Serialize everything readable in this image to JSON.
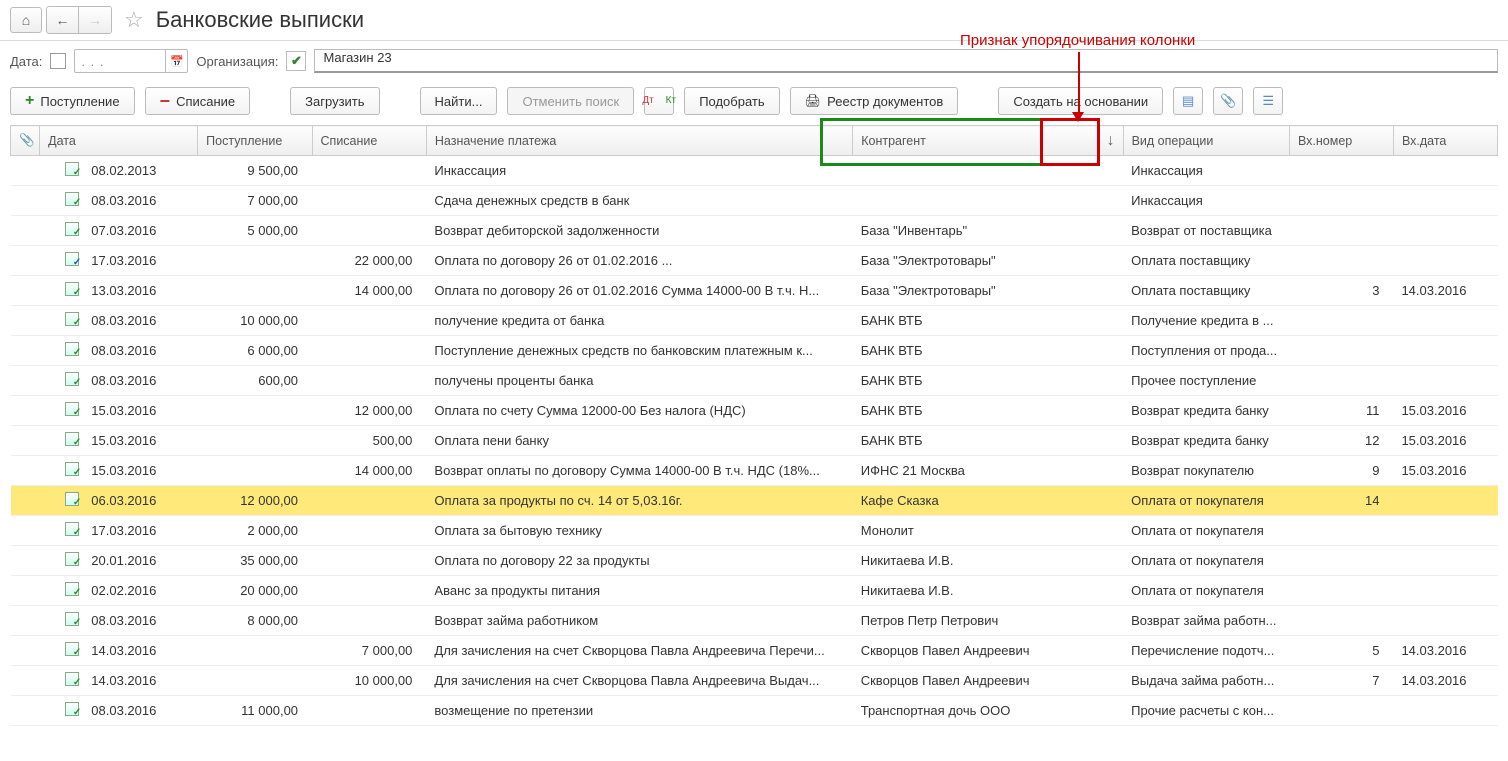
{
  "header": {
    "title": "Банковские выписки"
  },
  "filter": {
    "date_label": "Дата:",
    "date_placeholder": ". . .",
    "org_label": "Организация:",
    "org_value": "Магазин 23"
  },
  "toolbar": {
    "receipt": "Поступление",
    "write_off": "Списание",
    "load": "Загрузить",
    "find": "Найти...",
    "cancel_search": "Отменить поиск",
    "pick": "Подобрать",
    "registry": "Реестр документов",
    "create_based": "Создать на основании"
  },
  "columns": {
    "attach": "",
    "date": "Дата",
    "in": "Поступление",
    "out": "Списание",
    "purpose": "Назначение платежа",
    "agent": "Контрагент",
    "sort_indicator": "↓",
    "op": "Вид операции",
    "num": "Вх.номер",
    "indate": "Вх.дата"
  },
  "annotation": {
    "text": "Признак упорядочивания колонки"
  },
  "rows": [
    {
      "icon": "g",
      "date": "08.02.2013",
      "in": "9 500,00",
      "out": "",
      "purpose": "Инкассация",
      "agent": "",
      "op": "Инкассация",
      "num": "",
      "indate": ""
    },
    {
      "icon": "g",
      "date": "08.03.2016",
      "in": "7 000,00",
      "out": "",
      "purpose": "Сдача денежных средств в банк",
      "agent": "",
      "op": "Инкассация",
      "num": "",
      "indate": ""
    },
    {
      "icon": "g",
      "date": "07.03.2016",
      "in": "5 000,00",
      "out": "",
      "purpose": "Возврат дебиторской задолженности",
      "agent": "База \"Инвентарь\"",
      "op": "Возврат от поставщика",
      "num": "",
      "indate": ""
    },
    {
      "icon": "b",
      "date": "17.03.2016",
      "in": "",
      "out": "22 000,00",
      "purpose": "Оплата по договору 26 от 01.02.2016 ...",
      "agent": "База \"Электротовары\"",
      "op": "Оплата поставщику",
      "num": "",
      "indate": ""
    },
    {
      "icon": "g",
      "date": "13.03.2016",
      "in": "",
      "out": "14 000,00",
      "purpose": "Оплата по договору 26 от 01.02.2016 Сумма 14000-00 В т.ч. Н...",
      "agent": "База \"Электротовары\"",
      "op": "Оплата поставщику",
      "num": "3",
      "indate": "14.03.2016"
    },
    {
      "icon": "g",
      "date": "08.03.2016",
      "in": "10 000,00",
      "out": "",
      "purpose": "получение кредита от банка",
      "agent": "БАНК ВТБ",
      "op": "Получение кредита в ...",
      "num": "",
      "indate": ""
    },
    {
      "icon": "g",
      "date": "08.03.2016",
      "in": "6 000,00",
      "out": "",
      "purpose": "Поступление денежных средств по банковским платежным к...",
      "agent": "БАНК ВТБ",
      "op": "Поступления от прода...",
      "num": "",
      "indate": ""
    },
    {
      "icon": "g",
      "date": "08.03.2016",
      "in": "600,00",
      "out": "",
      "purpose": "получены проценты банка",
      "agent": "БАНК ВТБ",
      "op": "Прочее поступление",
      "num": "",
      "indate": ""
    },
    {
      "icon": "g",
      "date": "15.03.2016",
      "in": "",
      "out": "12 000,00",
      "purpose": "Оплата по счету Сумма 12000-00 Без налога (НДС)",
      "agent": "БАНК ВТБ",
      "op": "Возврат кредита банку",
      "num": "11",
      "indate": "15.03.2016"
    },
    {
      "icon": "g",
      "date": "15.03.2016",
      "in": "",
      "out": "500,00",
      "purpose": "Оплата пени банку",
      "agent": "БАНК ВТБ",
      "op": "Возврат кредита банку",
      "num": "12",
      "indate": "15.03.2016"
    },
    {
      "icon": "g",
      "date": "15.03.2016",
      "in": "",
      "out": "14 000,00",
      "purpose": "Возврат оплаты по договору Сумма 14000-00 В т.ч. НДС  (18%...",
      "agent": "ИФНС 21 Москва",
      "op": "Возврат покупателю",
      "num": "9",
      "indate": "15.03.2016"
    },
    {
      "icon": "g",
      "date": "06.03.2016",
      "in": "12 000,00",
      "out": "",
      "purpose": "Оплата за продукты по сч. 14 от 5,03.16г.",
      "agent": "Кафе Сказка",
      "op": "Оплата от покупателя",
      "num": "14",
      "indate": "",
      "selected": true
    },
    {
      "icon": "g",
      "date": "17.03.2016",
      "in": "2 000,00",
      "out": "",
      "purpose": "Оплата за бытовую технику",
      "agent": "Монолит",
      "op": "Оплата от покупателя",
      "num": "",
      "indate": ""
    },
    {
      "icon": "g",
      "date": "20.01.2016",
      "in": "35 000,00",
      "out": "",
      "purpose": "Оплата по договору 22 за продукты",
      "agent": "Никитаева И.В.",
      "op": "Оплата от покупателя",
      "num": "",
      "indate": ""
    },
    {
      "icon": "g",
      "date": "02.02.2016",
      "in": "20 000,00",
      "out": "",
      "purpose": "Аванс за продукты питания",
      "agent": "Никитаева И.В.",
      "op": "Оплата от покупателя",
      "num": "",
      "indate": ""
    },
    {
      "icon": "g",
      "date": "08.03.2016",
      "in": "8 000,00",
      "out": "",
      "purpose": "Возврат займа работником",
      "agent": "Петров Петр Петрович",
      "op": "Возврат займа работн...",
      "num": "",
      "indate": ""
    },
    {
      "icon": "g",
      "date": "14.03.2016",
      "in": "",
      "out": "7 000,00",
      "purpose": "Для зачисления на счет Скворцова Павла Андреевича Перечи...",
      "agent": "Скворцов Павел Андреевич",
      "op": "Перечисление подотч...",
      "num": "5",
      "indate": "14.03.2016"
    },
    {
      "icon": "g",
      "date": "14.03.2016",
      "in": "",
      "out": "10 000,00",
      "purpose": "Для зачисления на счет Скворцова Павла Андреевича Выдач...",
      "agent": "Скворцов Павел Андреевич",
      "op": "Выдача займа работн...",
      "num": "7",
      "indate": "14.03.2016"
    },
    {
      "icon": "g",
      "date": "08.03.2016",
      "in": "11 000,00",
      "out": "",
      "purpose": "возмещение по претензии",
      "agent": "Транспортная дочь ООО",
      "op": "Прочие расчеты с кон...",
      "num": "",
      "indate": ""
    }
  ]
}
